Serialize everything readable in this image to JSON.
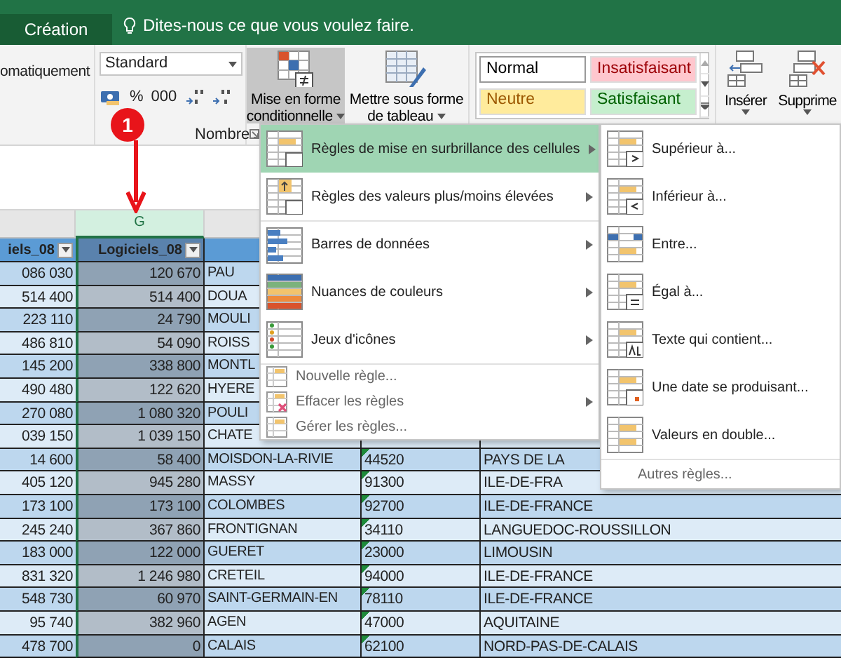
{
  "title_bar": {
    "tabs": [
      {
        "label": "Création",
        "selected": true
      }
    ],
    "tell_me": "Dites-nous ce que vous voulez faire."
  },
  "ribbon": {
    "autosum_label": "omatiquement",
    "number_group": {
      "format": "Standard",
      "percent": "%",
      "thousands": "000",
      "label": "Nombre"
    },
    "conditional_format_button": {
      "label_lines": [
        "Mise en forme",
        "conditionnelle"
      ],
      "expanded": true
    },
    "format_table_button": {
      "label_lines": [
        "Mettre sous forme",
        "de tableau"
      ]
    },
    "cell_styles": [
      {
        "label": "Normal",
        "kind": "normal",
        "color": "#ffffff"
      },
      {
        "label": "Insatisfaisant",
        "kind": "bad",
        "color": "#ffc7ce"
      },
      {
        "label": "Neutre",
        "kind": "neutral",
        "color": "#ffeb9c"
      },
      {
        "label": "Satisfaisant",
        "kind": "good",
        "color": "#c6efce"
      }
    ],
    "insert_button": {
      "label": "Insérer"
    },
    "delete_button": {
      "label": "Supprime"
    }
  },
  "callout": {
    "number": "1"
  },
  "sheet": {
    "columns": [
      {
        "selected": false
      },
      {
        "label": "G",
        "selected": true
      },
      {
        "selected": false
      }
    ],
    "headers": [
      "iels_08",
      "Logiciels_08"
    ],
    "rows": [
      {
        "f": "086 030",
        "g": "120 670",
        "city": "PAU"
      },
      {
        "f": "514 400",
        "g": "514 400",
        "city": "DOUA"
      },
      {
        "f": "223 110",
        "g": "24 790",
        "city": "MOULI"
      },
      {
        "f": "486 810",
        "g": "54 090",
        "city": "ROISS"
      },
      {
        "f": "145 200",
        "g": "338 800",
        "city": "MONTL"
      },
      {
        "f": "490 480",
        "g": "122 620",
        "city": "HYERE"
      },
      {
        "f": "270 080",
        "g": "1 080 320",
        "city": "POULI"
      },
      {
        "f": "039 150",
        "g": "1 039 150",
        "city": "CHATE"
      },
      {
        "f": "14 600",
        "g": "58 400",
        "city": "MOISDON-LA-RIVIE",
        "postal": "44520",
        "region": "PAYS DE LA"
      },
      {
        "f": "405 120",
        "g": "945 280",
        "city": "MASSY",
        "postal": "91300",
        "region": "ILE-DE-FRA"
      },
      {
        "f": "173 100",
        "g": "173 100",
        "city": "COLOMBES",
        "postal": "92700",
        "region": "ILE-DE-FRANCE"
      },
      {
        "f": "245 240",
        "g": "367 860",
        "city": "FRONTIGNAN",
        "postal": "34110",
        "region": "LANGUEDOC-ROUSSILLON"
      },
      {
        "f": "183 000",
        "g": "122 000",
        "city": "GUERET",
        "postal": "23000",
        "region": "LIMOUSIN"
      },
      {
        "f": "831 320",
        "g": "1 246 980",
        "city": "CRETEIL",
        "postal": "94000",
        "region": "ILE-DE-FRANCE"
      },
      {
        "f": "548 730",
        "g": "60 970",
        "city": "SAINT-GERMAIN-EN",
        "postal": "78110",
        "region": "ILE-DE-FRANCE"
      },
      {
        "f": "95 740",
        "g": "382 960",
        "city": "AGEN",
        "postal": "47000",
        "region": "AQUITAINE"
      },
      {
        "f": "478 700",
        "g": "0",
        "city": "CALAIS",
        "postal": "62100",
        "region": "NORD-PAS-DE-CALAIS"
      }
    ]
  },
  "menu": {
    "items": [
      {
        "label": "Règles de mise en surbrillance des cellules",
        "kind": "large",
        "selected": true,
        "has_submenu": true,
        "divider_before": false
      },
      {
        "label": "Règles des valeurs plus/moins élevées",
        "kind": "large",
        "selected": false,
        "has_submenu": true,
        "divider_before": false
      },
      {
        "label": "Barres de données",
        "kind": "large",
        "selected": false,
        "has_submenu": true,
        "divider_before": true
      },
      {
        "label": "Nuances de couleurs",
        "kind": "large",
        "selected": false,
        "has_submenu": true,
        "divider_before": false
      },
      {
        "label": "Jeux d'icônes",
        "kind": "large",
        "selected": false,
        "has_submenu": true,
        "divider_before": false
      },
      {
        "label": "Nouvelle règle...",
        "kind": "small",
        "selected": false,
        "has_submenu": false,
        "divider_before": true
      },
      {
        "label": "Effacer les règles",
        "kind": "small",
        "selected": false,
        "has_submenu": true,
        "divider_before": false
      },
      {
        "label": "Gérer les règles...",
        "kind": "small",
        "selected": false,
        "has_submenu": false,
        "divider_before": false
      }
    ]
  },
  "submenu": {
    "items": [
      {
        "label": "Supérieur à...",
        "kind": "large"
      },
      {
        "label": "Inférieur à...",
        "kind": "large"
      },
      {
        "label": "Entre...",
        "kind": "large"
      },
      {
        "label": "Égal à...",
        "kind": "large"
      },
      {
        "label": "Texte qui contient...",
        "kind": "large"
      },
      {
        "label": "Une date se produisant...",
        "kind": "large"
      },
      {
        "label": "Valeurs en double...",
        "kind": "large"
      },
      {
        "label": "Autres règles...",
        "kind": "small"
      }
    ]
  }
}
